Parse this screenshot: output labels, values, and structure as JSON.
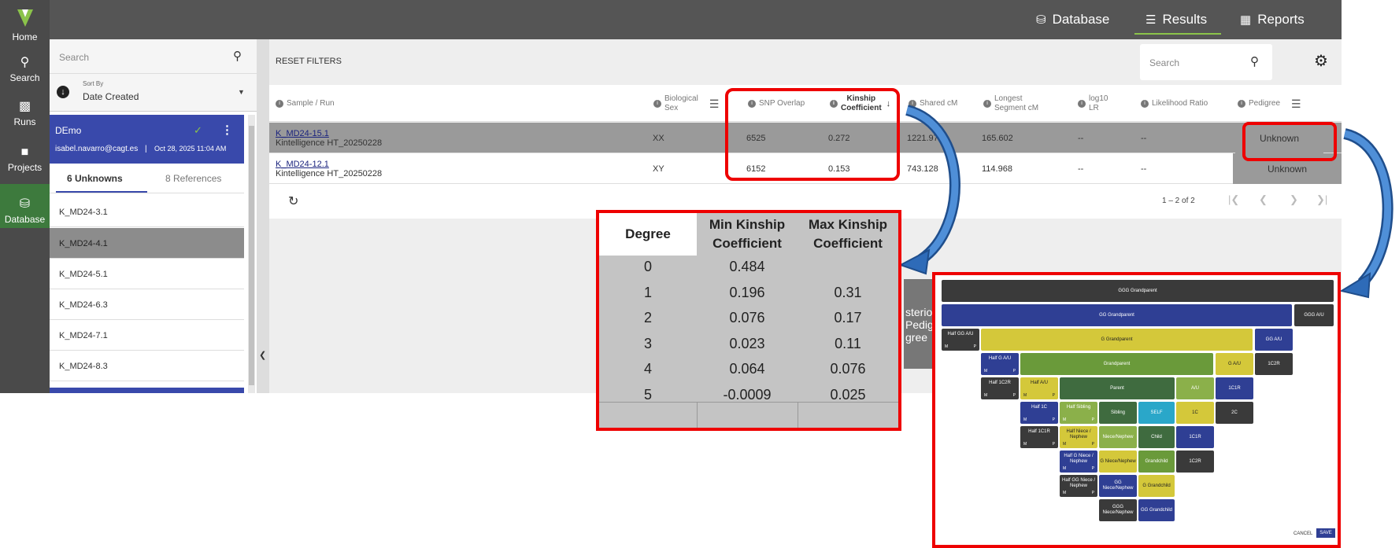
{
  "rail": {
    "logo_letter": "V",
    "items": [
      {
        "label": "Home",
        "icon": "home-logo-icon"
      },
      {
        "label": "Search",
        "icon": "search-icon"
      },
      {
        "label": "Runs",
        "icon": "runs-icon"
      },
      {
        "label": "Projects",
        "icon": "folder-icon"
      },
      {
        "label": "Database",
        "icon": "database-icon"
      }
    ]
  },
  "topnav": {
    "database": "Database",
    "results": "Results",
    "reports": "Reports"
  },
  "left_panel": {
    "search_placeholder": "Search",
    "sort_label": "Sort By",
    "sort_value": "Date Created",
    "card": {
      "name": "DEmo",
      "email": "isabel.navarro@cagt.es",
      "separator": "|",
      "date": "Oct 28, 2025 11:04 AM"
    },
    "tab_unknowns": "6 Unknowns",
    "tab_references": "8 References",
    "items": [
      "K_MD24-3.1",
      "K_MD24-4.1",
      "K_MD24-5.1",
      "K_MD24-6.3",
      "K_MD24-7.1",
      "K_MD24-8.3"
    ]
  },
  "main": {
    "reset_filters": "RESET FILTERS",
    "search_placeholder": "Search",
    "columns": {
      "sample_run": "Sample / Run",
      "biological_sex_1": "Biological",
      "biological_sex_2": "Sex",
      "snp_overlap": "SNP Overlap",
      "kinship_1": "Kinship",
      "kinship_2": "Coefficient",
      "shared_cm": "Shared cM",
      "longest_1": "Longest",
      "longest_2": "Segment cM",
      "log10_1": "log10",
      "log10_2": "LR",
      "likelihood_ratio": "Likelihood Ratio",
      "pedigree": "Pedigree"
    },
    "rows": [
      {
        "sample": "K_MD24-15.1",
        "run": "Kintelligence HT_20250228",
        "sex": "XX",
        "snp": "6525",
        "kinship": "0.272",
        "shared": "1221.97",
        "longest": "165.602",
        "log10": "--",
        "lr": "--",
        "pedigree": "Unknown"
      },
      {
        "sample": "K_MD24-12.1",
        "run": "Kintelligence HT_20250228",
        "sex": "XY",
        "snp": "6152",
        "kinship": "0.153",
        "shared": "743.128",
        "longest": "114.968",
        "log10": "--",
        "lr": "--",
        "pedigree": "Unknown"
      }
    ],
    "pagination": "1 – 2 of 2",
    "hidden_text_1": "sterio",
    "hidden_text_2": "Pedig",
    "hidden_text_3": "gree"
  },
  "kinship_table": {
    "headers": [
      "Degree",
      "Min Kinship Coefficient",
      "Max Kinship Coefficient"
    ],
    "rows": [
      {
        "degree": "0",
        "min": "0.484",
        "max": ""
      },
      {
        "degree": "1",
        "min": "0.196",
        "max": "0.31"
      },
      {
        "degree": "2",
        "min": "0.076",
        "max": "0.17"
      },
      {
        "degree": "3",
        "min": "0.023",
        "max": "0.11"
      },
      {
        "degree": "4",
        "min": "0.064",
        "max": "0.076"
      },
      {
        "degree": "5",
        "min": "-0.0009",
        "max": "0.025"
      }
    ]
  },
  "pedigree_chart": {
    "ggg_grandparent": "GGG Grandparent",
    "gg_grandparent": "GG Grandparent",
    "ggg_au": "GGG A/U",
    "half_gg_au": "Half GG A/U",
    "g_grandparent": "G Grandparent",
    "gg_au": "GG A/U",
    "half_g_au": "Half G A/U",
    "grandparent": "Grandparent",
    "g_au": "G A/U",
    "c2r": "1C2R",
    "half_1c2r": "Half 1C2R",
    "half_au": "Half A/U",
    "parent": "Parent",
    "au": "A/U",
    "c1r": "1C1R",
    "half_1c": "Half 1C",
    "half_sibling": "Half Sibling",
    "sibling": "Sibling",
    "self": "SELF",
    "c1": "1C",
    "c2": "2C",
    "half_1c1r": "Half 1C1R",
    "half_niece": "Half Niece / Nephew",
    "niece": "Niece/Nephew",
    "child": "Child",
    "c1r_b": "1C1R",
    "half_g_niece": "Half G Niece / Nephew",
    "g_niece": "G Niece/Nephew",
    "grandchild": "Grandchild",
    "c2r_b": "1C2R",
    "half_gg_niece": "Half GG Niece / Nephew",
    "gg_niece": "GG Niece/Nephew",
    "g_grandchild": "G Grandchild",
    "ggg_niece": "GGG Niece/Nephew",
    "gg_grandchild": "GG Grandchild",
    "m": "M",
    "p": "P",
    "cancel": "CANCEL",
    "save": "SAVE"
  }
}
